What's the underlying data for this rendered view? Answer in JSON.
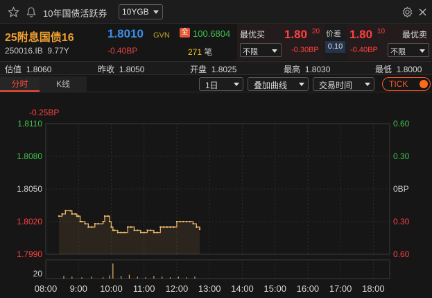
{
  "titlebar": {
    "title": "10年国债活跃券",
    "dropdown_value": "10YGB"
  },
  "quote": {
    "name": "25附息国债16",
    "price": "1.8010",
    "price_unit": "GVN",
    "full_badge": "全",
    "full_price": "100.6804",
    "code": "250016.IB",
    "term": "9.77Y",
    "change": "-0.40BP",
    "volume": "271",
    "volume_unit": "笔"
  },
  "bid": {
    "label": "最优买",
    "price": "1.80",
    "sub": "20",
    "change": "-0.30BP",
    "filter": "不限"
  },
  "spread": {
    "label": "价差",
    "value": "0.10"
  },
  "ask": {
    "label": "最优卖",
    "price": "1.80",
    "sub": "10",
    "change": "-0.40BP",
    "filter": "不限"
  },
  "stats": {
    "valuation_label": "估值",
    "valuation": "1.8060",
    "prev_close_label": "昨收",
    "prev_close": "1.8050",
    "open_label": "开盘",
    "open": "1.8025",
    "high_label": "最高",
    "high": "1.8030",
    "low_label": "最低",
    "low": "1.8000"
  },
  "toolbar": {
    "tab_intraday": "分时",
    "tab_kline": "K线",
    "period": "1日",
    "overlay": "叠加曲线",
    "session": "交易时间",
    "tick": "TICK"
  },
  "colors": {
    "up": "#ff4040",
    "down": "#3fc04a",
    "accent": "#f0a030",
    "line": "#e8b060",
    "price_blue": "#3c8fe8"
  },
  "chart_data": {
    "type": "line",
    "top_annotation": "-0.25BP",
    "y_ticks_left": [
      "1.8110",
      "1.8080",
      "1.8050",
      "1.8020",
      "1.7990"
    ],
    "y_ticks_right": [
      "0.60",
      "0.30",
      "0BP",
      "0.30",
      "0.60"
    ],
    "ylim": [
      1.799,
      1.811
    ],
    "x_ticks": [
      "08:00",
      "9:00",
      "10:00",
      "11:00",
      "12:00",
      "13:00",
      "14:00",
      "15:00",
      "16:00",
      "17:00",
      "18:00"
    ],
    "x_range_hours": [
      8,
      18.5
    ],
    "series": [
      {
        "x": [
          8.4,
          8.5,
          8.6,
          8.75,
          8.8,
          8.9,
          8.95,
          9.0,
          9.05,
          9.1,
          9.2,
          9.3,
          9.4,
          9.5,
          9.6,
          9.75,
          9.8,
          9.9,
          9.95,
          10.0,
          10.05,
          10.1,
          10.2,
          10.3,
          10.4,
          10.5,
          10.6,
          10.7,
          10.8,
          10.9,
          11.0,
          11.1,
          11.2,
          11.3,
          11.4,
          11.5,
          11.6,
          11.7,
          11.8,
          11.9,
          12.0,
          12.1,
          12.2,
          12.3,
          12.4,
          12.5,
          12.6,
          12.7
        ],
        "y": [
          1.8025,
          1.8027,
          1.803,
          1.803,
          1.8027,
          1.8027,
          1.8025,
          1.8025,
          1.802,
          1.802,
          1.8018,
          1.8015,
          1.8015,
          1.8018,
          1.8018,
          1.802,
          1.8025,
          1.8025,
          1.802,
          1.8015,
          1.8012,
          1.8012,
          1.801,
          1.801,
          1.801,
          1.8015,
          1.8015,
          1.8012,
          1.8012,
          1.801,
          1.801,
          1.8012,
          1.8012,
          1.801,
          1.801,
          1.8015,
          1.8015,
          1.8015,
          1.8015,
          1.8015,
          1.802,
          1.802,
          1.802,
          1.802,
          1.802,
          1.8018,
          1.8015,
          1.8013
        ]
      }
    ],
    "volume_tick": "20",
    "volume": {
      "x": [
        8.55,
        8.8,
        9.1,
        9.4,
        9.75,
        9.95,
        10.05,
        10.3,
        10.55,
        10.8,
        11.05,
        11.3,
        11.55,
        11.8,
        12.05,
        12.3,
        12.55
      ],
      "values": [
        4,
        3,
        2,
        3,
        2,
        5,
        24,
        4,
        6,
        3,
        2,
        4,
        3,
        2,
        3,
        2,
        3
      ],
      "max": 30
    }
  }
}
